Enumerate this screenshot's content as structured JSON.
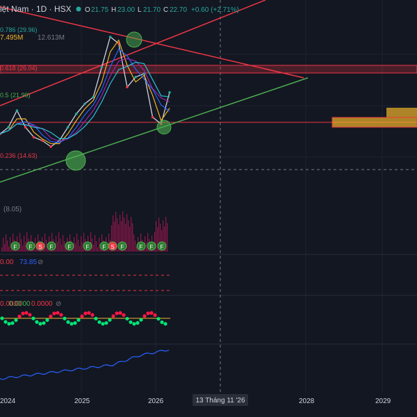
{
  "header": {
    "symbol": "iệt Nam · 1D · HSX",
    "ohlc": [
      {
        "key": "O",
        "value": "21.75"
      },
      {
        "key": "H",
        "value": "23.00"
      },
      {
        "key": "L",
        "value": "21.70"
      },
      {
        "key": "C",
        "value": "22.70"
      }
    ],
    "change": "+0.60 (+2.71%)",
    "colors": {
      "up": "#26a69a",
      "text": "#d1d4dc"
    }
  },
  "fib_labels": [
    {
      "text": "0.786 (29.96)",
      "color": "#26a69a"
    },
    {
      "text": "0.618 (26.04)",
      "color": "#f23645"
    },
    {
      "text": "0.5 (21.99)",
      "color": "#4caf50"
    },
    {
      "text": "0.236 (14.63)",
      "color": "#f23645"
    }
  ],
  "volume_labels": {
    "left": "7.495M",
    "right": "12.613M"
  },
  "volume_ma_label": "(8.05)",
  "indicator1": {
    "values": [
      "0.00",
      "73.85"
    ]
  },
  "indicator2": {
    "values": [
      "0.0000",
      "0.0000",
      "0.0000"
    ]
  },
  "time_axis": {
    "ticks": [
      "2024",
      "2025",
      "2026",
      "2028",
      "2029"
    ],
    "crosshair_label": "13 Tháng 11 '26"
  },
  "colors": {
    "background": "#131722",
    "grid": "#1f2330",
    "red_line": "#f23645",
    "green_line": "#4caf50",
    "orange_zone": "#f0b429",
    "volume": "#c2185b",
    "bottom_line": "#2962ff"
  },
  "chart_data": {
    "type": "line",
    "title": "",
    "x": [
      "2023-11",
      "2024-01",
      "2024-03",
      "2024-05",
      "2024-07",
      "2024-09",
      "2024-11",
      "2025-01",
      "2025-03",
      "2025-04",
      "2025-05",
      "2025-06",
      "2025-07",
      "2025-08",
      "2025-09",
      "2025-10",
      "2025-11",
      "2025-12",
      "2026-01",
      "2026-02",
      "2026-03"
    ],
    "series": [
      {
        "values": [
          16.5,
          17.5,
          20.0,
          17.5,
          16.0,
          15.5,
          14.6,
          15.5,
          17.5,
          19.5,
          21.0,
          22.0,
          26.5,
          31.0,
          30.0,
          23.5,
          25.0,
          25.5,
          19.0,
          18.0,
          22.7
        ]
      }
    ],
    "horizontal_levels": [
      {
        "name": "0.786",
        "value": 29.96
      },
      {
        "name": "0.618",
        "value": 26.04
      },
      {
        "name": "0.5",
        "value": 21.99
      },
      {
        "name": "0.236",
        "value": 14.63
      }
    ],
    "ylim": [
      9.0,
      36.5
    ],
    "marker_labels": [
      "F",
      "F",
      "S",
      "F",
      "F",
      "F",
      "F",
      "S",
      "F",
      "F",
      "F",
      "F"
    ]
  }
}
